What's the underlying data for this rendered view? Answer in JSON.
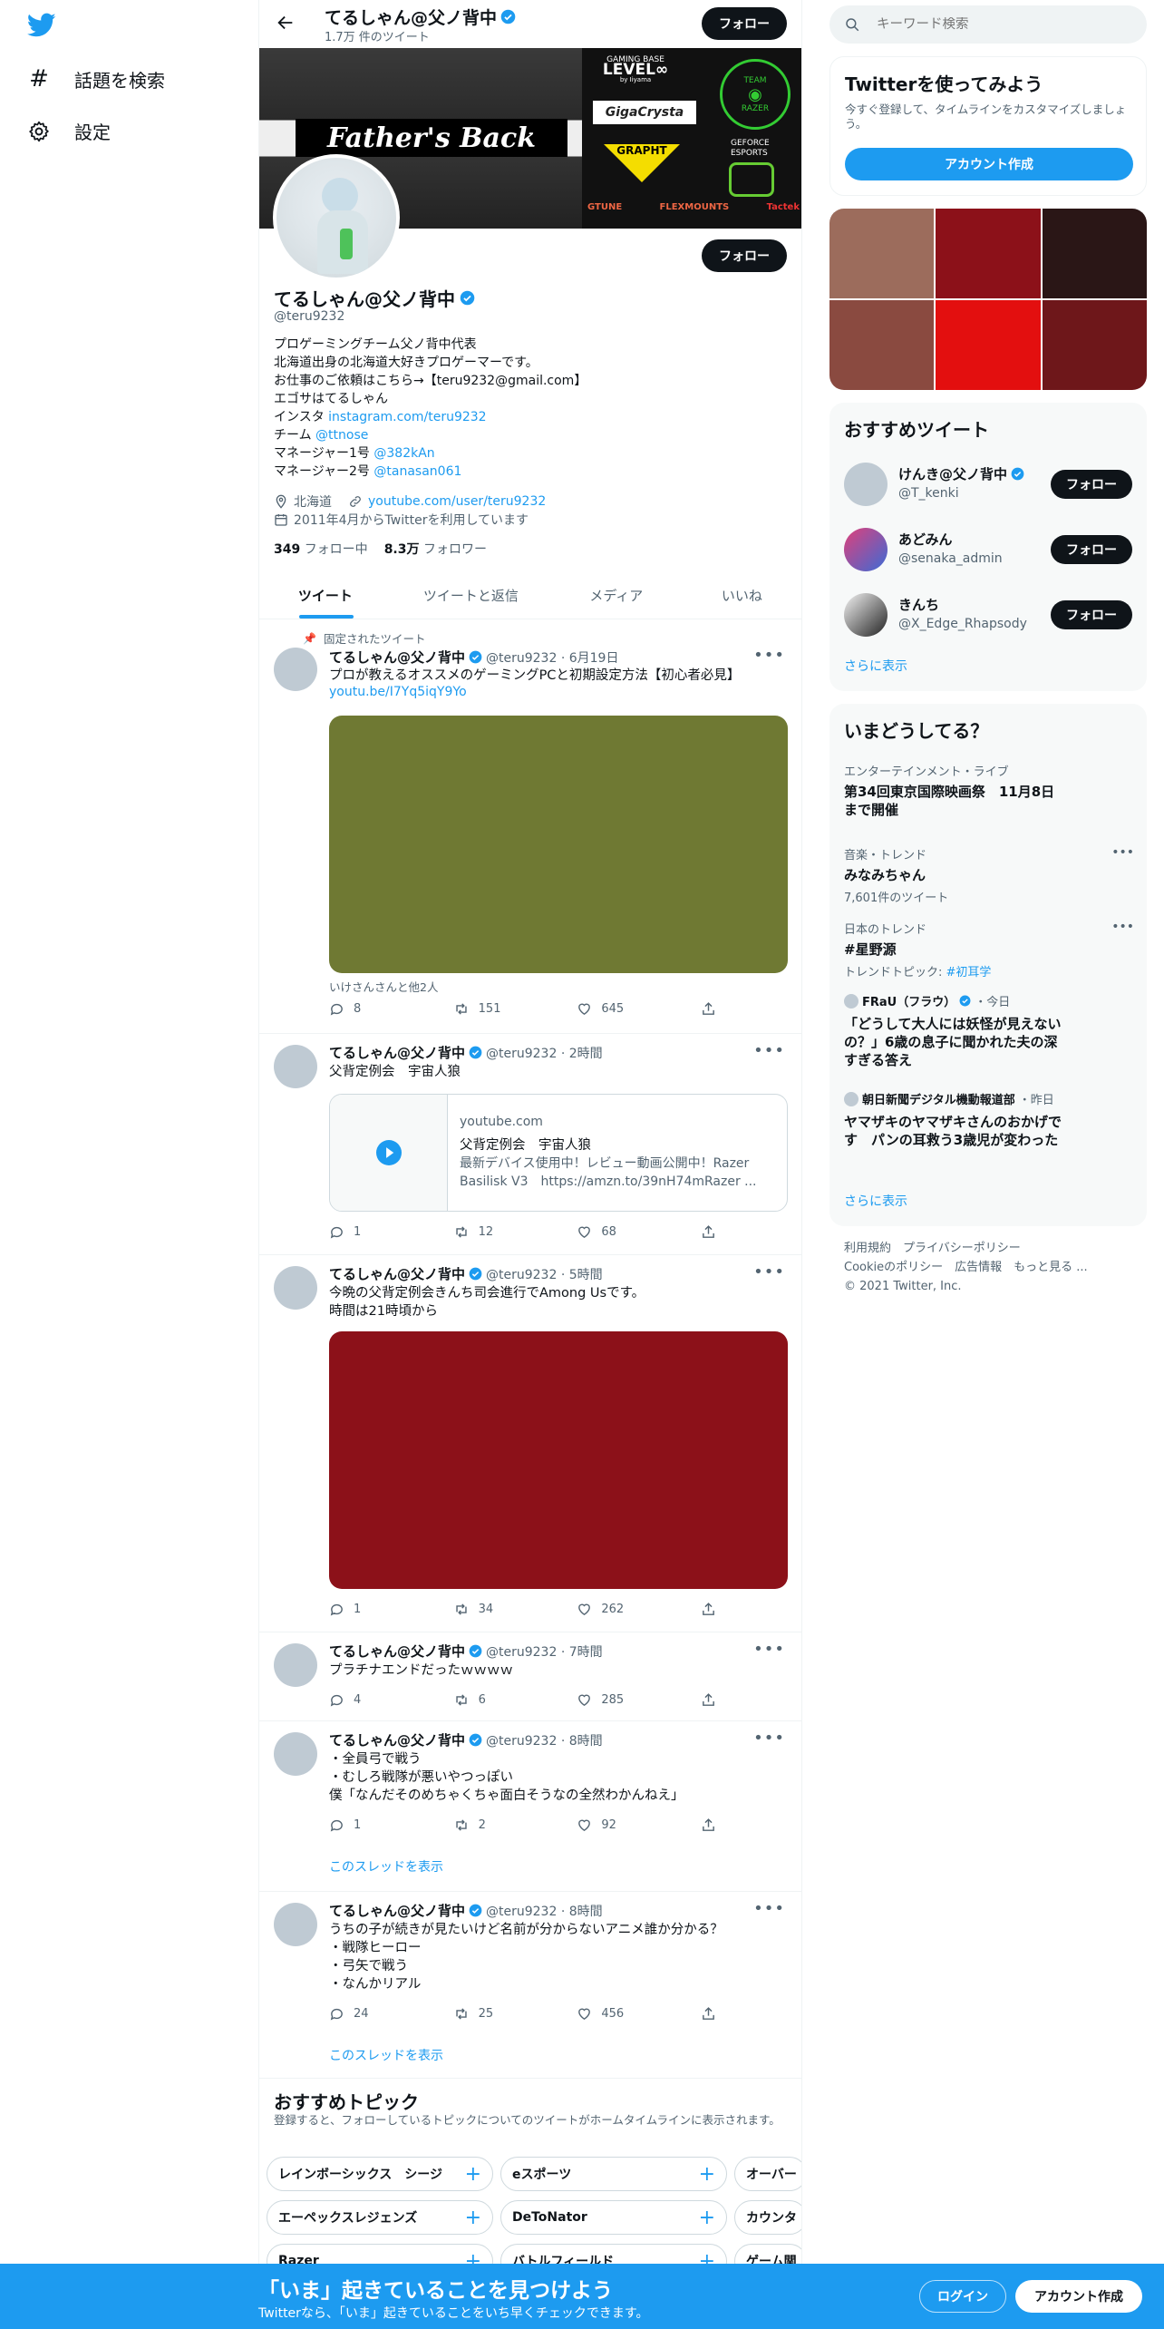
{
  "nav": {
    "explore_label": "話題を検索",
    "settings_label": "設定"
  },
  "header": {
    "name": "てるしゃん@父ノ背中",
    "tweet_count": "1.7万 件のツイート",
    "follow_label": "フォロー"
  },
  "banner_art": {
    "headline": "Father's Back",
    "sponsors": [
      "GAMING BASE",
      "LEVEL∞",
      "by Iiyama",
      "GigaCrysta",
      "GRAPHT",
      "GEFORCE",
      "ESPORTS",
      "TEAM",
      "RAZER",
      "GTUNE",
      "FLEXMOUNTS",
      "Tactek"
    ]
  },
  "profile": {
    "name": "てるしゃん@父ノ背中",
    "handle": "@teru9232",
    "follow_label": "フォロー",
    "bio": [
      {
        "text": "プロゲーミングチーム父ノ背中代表",
        "link": ""
      },
      {
        "text": "北海道出身の北海道大好きプロゲーマーです。",
        "link": ""
      },
      {
        "text": "お仕事のご依頼はこちら→【teru9232@gmail.com】",
        "link": ""
      },
      {
        "text": "エゴサはてるしゃん",
        "link": ""
      },
      {
        "text": "インスタ ",
        "link": "instagram.com/teru9232"
      },
      {
        "text": "チーム ",
        "link": "@ttnose"
      },
      {
        "text": "マネージャー1号 ",
        "link": "@382kAn"
      },
      {
        "text": "マネージャー2号 ",
        "link": "@tanasan061"
      }
    ],
    "location": "北海道",
    "website": "youtube.com/user/teru9232",
    "joined": "2011年4月からTwitterを利用しています",
    "following_count": "349",
    "following_label": "フォロー中",
    "followers_count": "8.3万",
    "followers_label": "フォロワー"
  },
  "tabs": [
    {
      "label": "ツイート",
      "active": true
    },
    {
      "label": "ツイートと返信",
      "active": false
    },
    {
      "label": "メディア",
      "active": false
    },
    {
      "label": "いいね",
      "active": false
    }
  ],
  "tweets": [
    {
      "pinned_label": "固定されたツイート",
      "name": "てるしゃん@父ノ背中",
      "meta": "@teru9232 · 6月19日",
      "text": "プロが教えるオススメのゲーミングPCと初期設定方法【初心者必見】",
      "link": "youtu.be/I7Yq5iqY9Yo",
      "media_color": "#6f7933",
      "caption": "いけさんさんと他2人",
      "replies": "8",
      "retweets": "151",
      "likes": "645"
    },
    {
      "name": "てるしゃん@父ノ背中",
      "meta": "@teru9232 · 2時間",
      "text": "父背定例会　宇宙人狼",
      "card_domain": "youtube.com",
      "card_title": "父背定例会　宇宙人狼",
      "card_desc": "最新デバイス使用中！レビュー動画公開中！Razer Basilisk V3　https://amzn.to/39nH74mRazer ...",
      "replies": "1",
      "retweets": "12",
      "likes": "68"
    },
    {
      "name": "てるしゃん@父ノ背中",
      "meta": "@teru9232 · 5時間",
      "text": "今晩の父背定例会きんち司会進行でAmong Usです。\n時間は21時頃から",
      "media_color": "#8c1119",
      "replies": "1",
      "retweets": "34",
      "likes": "262"
    },
    {
      "name": "てるしゃん@父ノ背中",
      "meta": "@teru9232 · 7時間",
      "text": "プラチナエンドだったｗｗｗｗ",
      "replies": "4",
      "retweets": "6",
      "likes": "285"
    },
    {
      "name": "てるしゃん@父ノ背中",
      "meta": "@teru9232 · 8時間",
      "text": "・全員弓で戦う\n・むしろ戦隊が悪いやつっぽい\n僕「なんだそのめちゃくちゃ面白そうなの全然わかんねえ」",
      "replies": "1",
      "retweets": "2",
      "likes": "92",
      "thread_label": "このスレッドを表示"
    },
    {
      "name": "てるしゃん@父ノ背中",
      "meta": "@teru9232 · 8時間",
      "text": "うちの子が続きが見たいけど名前が分からないアニメ誰か分かる？\n・戦隊ヒーロー\n・弓矢で戦う\n・なんかリアル",
      "replies": "24",
      "retweets": "25",
      "likes": "456",
      "thread_label": "このスレッドを表示"
    }
  ],
  "topics": {
    "title": "おすすめトピック",
    "desc": "登録すると、フォローしているトピックについてのツイートがホームタイムラインに表示されます。",
    "row1": [
      "レインボーシックス　シージ",
      "eスポーツ",
      "オーバー"
    ],
    "row2": [
      "エーペックスレジェンズ",
      "DeToNator",
      "カウンタ"
    ],
    "row3": [
      "Razer",
      "バトルフィールド",
      "ゲーム関"
    ]
  },
  "search": {
    "placeholder": "キーワード検索"
  },
  "signup": {
    "title": "Twitterを使ってみよう",
    "desc": "今すぐ登録して、タイムラインをカスタマイズしましょう。",
    "button": "アカウント作成"
  },
  "media_grid_colors": [
    "#9c6c5c",
    "#8c1119",
    "#2a1616",
    "#8a4a40",
    "#e30f0f",
    "#6e171a"
  ],
  "who_to_follow": {
    "title": "おすすめツイート",
    "users": [
      {
        "name": "けんき@父ノ背中",
        "handle": "@T_kenki",
        "verified": true
      },
      {
        "name": "あどみん",
        "handle": "@senaka_admin",
        "verified": false
      },
      {
        "name": "きんち",
        "handle": "@X_Edge_Rhapsody",
        "verified": false
      }
    ],
    "follow_label": "フォロー",
    "more": "さらに表示"
  },
  "trends": {
    "title": "いまどうしてる？",
    "items": [
      {
        "context": "エンターテインメント・ライブ",
        "title": "第34回東京国際映画祭　11月8日まで開催",
        "sub": ""
      },
      {
        "context": "音楽・トレンド",
        "title": "みなみちゃん",
        "sub": "7,601件のツイート"
      },
      {
        "context": "日本のトレンド",
        "title": "#星野源",
        "sub": "トレンドトピック: ",
        "sub_link": "#初耳学"
      }
    ],
    "news": [
      {
        "source": "FRaU（フラウ）",
        "time": "・今日",
        "title": "「どうして大人には妖怪が見えないの？」6歳の息子に聞かれた夫の深すぎる答え"
      },
      {
        "source": "朝日新聞デジタル機動報道部",
        "time": "・昨日",
        "title": "ヤマザキのヤマザキさんのおかげです　パンの耳救う3歳児が変わった"
      }
    ],
    "more": "さらに表示"
  },
  "footer": {
    "line1": "利用規約　プライバシーポリシー",
    "line2": "Cookieのポリシー　広告情報　もっと見る ...",
    "line3": "© 2021 Twitter, Inc."
  },
  "bottom_banner": {
    "title": "「いま」起きていることを見つけよう",
    "desc": "Twitterなら、「いま」起きていることをいち早くチェックできます。",
    "login": "ログイン",
    "signup": "アカウント作成"
  },
  "colors": {
    "accent": "#1d9bf0",
    "dark": "#0f1419",
    "muted": "#536471"
  }
}
